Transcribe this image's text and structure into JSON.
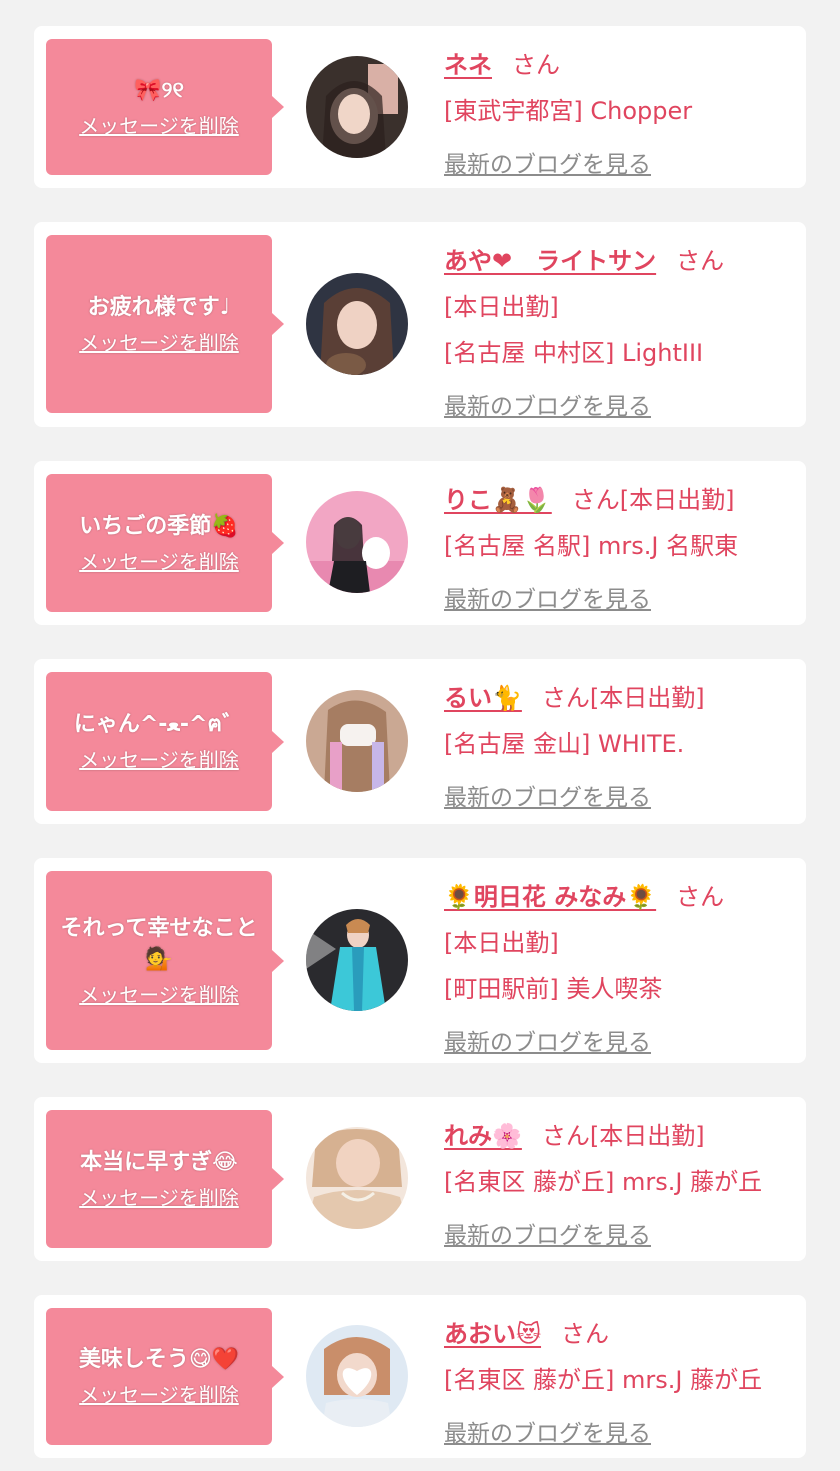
{
  "suffix": "さん",
  "delete_label": "メッセージを削除",
  "blog_label": "最新のブログを見る",
  "colors": {
    "accent": "#e0455f",
    "bubble": "#f4899a",
    "link_gray": "#8c8c8c",
    "page_bg": "#f2f2f2"
  },
  "cards": [
    {
      "message": "🎀୨୧",
      "name": "ネネ",
      "meta1": "",
      "meta2": "[東武宇都宮] Chopper"
    },
    {
      "message": "お疲れ様です♩",
      "name": "あや❤︎　ライトサン",
      "meta1": "[本日出勤]",
      "meta2": "[名古屋 中村区] LightIII"
    },
    {
      "message": "いちごの季節🍓",
      "name": "りこ🧸🌷",
      "meta1": "[本日出勤]",
      "meta2": "[名古屋 名駅] mrs.J 名駅東"
    },
    {
      "message": "にゃん^-ﻌ-^ฅ゛",
      "name": "るい🐈",
      "meta1": "[本日出勤]",
      "meta2": "[名古屋 金山] WHITE."
    },
    {
      "message": "それって幸せなこと💁",
      "name": "🌻明日花 みなみ🌻",
      "meta1": "[本日出勤]",
      "meta2": "[町田駅前] 美人喫茶"
    },
    {
      "message": "本当に早すぎ😂",
      "name": "れみ🌸",
      "meta1": "[本日出勤]",
      "meta2": "[名東区 藤が丘] mrs.J 藤が丘"
    },
    {
      "message": "美味しそう😋❤️",
      "name": "あおい😻",
      "meta1": "",
      "meta2": "[名東区 藤が丘] mrs.J 藤が丘"
    }
  ]
}
